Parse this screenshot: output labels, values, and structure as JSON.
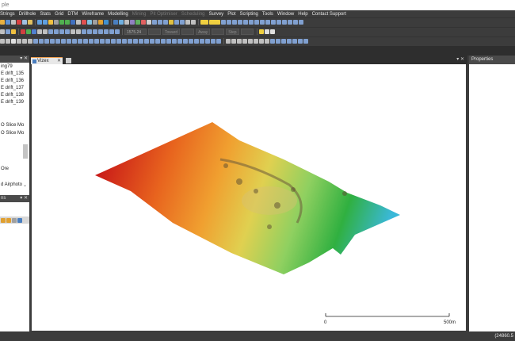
{
  "window": {
    "title": "ple"
  },
  "menu": [
    {
      "label": "Strings",
      "enabled": true
    },
    {
      "label": "Drillhole",
      "enabled": true
    },
    {
      "label": "Stats",
      "enabled": true
    },
    {
      "label": "Grid",
      "enabled": true
    },
    {
      "label": "DTM",
      "enabled": true
    },
    {
      "label": "Wireframe",
      "enabled": true
    },
    {
      "label": "Modelling",
      "enabled": true
    },
    {
      "label": "Mining",
      "enabled": false
    },
    {
      "label": "Pit Optimiser",
      "enabled": false
    },
    {
      "label": "Scheduling",
      "enabled": false
    },
    {
      "label": "Survey",
      "enabled": true
    },
    {
      "label": "Plot",
      "enabled": true
    },
    {
      "label": "Scripting",
      "enabled": true
    },
    {
      "label": "Tools",
      "enabled": true
    },
    {
      "label": "Window",
      "enabled": true
    },
    {
      "label": "Help",
      "enabled": true
    },
    {
      "label": "Contact Support",
      "enabled": true
    }
  ],
  "toolbar": {
    "elevation_value": "1575.24",
    "field_toward": "Toward",
    "field_away": "Away",
    "field_step": "Step"
  },
  "left_panel": {
    "tree_items": [
      "ing79",
      "E drift_135",
      "E drift_136",
      "E drift_137",
      "E drift_138",
      "E drift_139",
      "O Slice Mo",
      "O Slice Mo",
      "Ore",
      "d Airphoto"
    ],
    "second_panel_header": "ns"
  },
  "document": {
    "tab_label": "Vizex",
    "viewer_controls": "▾ ✕"
  },
  "viewport": {
    "scale_bar": {
      "start_label": "0",
      "end_label": "500m",
      "distance_m": 500
    },
    "surface_colors": [
      "#c81818",
      "#e8641e",
      "#f0a030",
      "#e0d050",
      "#8fd060",
      "#30b040",
      "#3ab8d8"
    ]
  },
  "right_panel": {
    "title": "Properties"
  },
  "status": {
    "coords": "(24860.5"
  },
  "icons": {
    "panel_pin": "pin-icon",
    "panel_close": "close-icon",
    "tab": "vizex-icon",
    "new_tab": "new-tab-icon"
  }
}
